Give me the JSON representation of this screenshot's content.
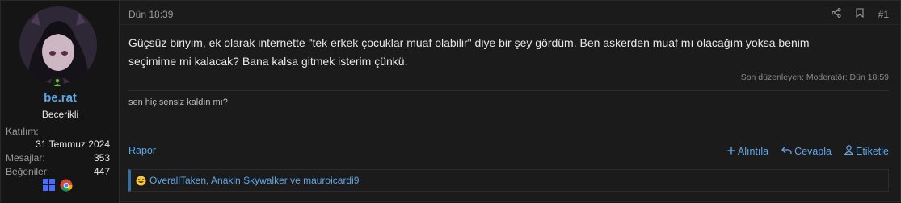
{
  "user": {
    "name": "be.rat",
    "title": "Becerikli",
    "stats": [
      {
        "label": "Katılım:",
        "value": "31 Temmuz 2024"
      },
      {
        "label": "Mesajlar:",
        "value": "353"
      },
      {
        "label": "Beğeniler:",
        "value": "447"
      }
    ],
    "icons": [
      "windows-icon",
      "chrome-icon",
      "online-status-icon"
    ]
  },
  "post": {
    "date": "Dün 18:39",
    "number": "#1",
    "body_line1": "Güçsüz biriyim, ek olarak internette \"tek erkek çocuklar muaf olabilir\" diye bir şey gördüm. Ben askerden muaf mı olacağım yoksa benim",
    "body_line2": "seçimime mi kalacak? Bana kalsa gitmek isterim çünkü.",
    "edited": "Son düzenleyen: Moderatör: Dün 18:59",
    "signature": "sen hiç sensiz kaldın mı?",
    "report": "Rapor",
    "quote": "Alıntıla",
    "reply": "Cevapla",
    "tag": "Etiketle",
    "reactions": "OverallTaken, Anakin Skywalker ve mauroicardi9",
    "header_icons": [
      "share-icon",
      "bookmark-icon"
    ]
  },
  "colors": {
    "accent": "#5fa6e8",
    "background": "#1b1b1b",
    "online": "#6fbf3a"
  }
}
